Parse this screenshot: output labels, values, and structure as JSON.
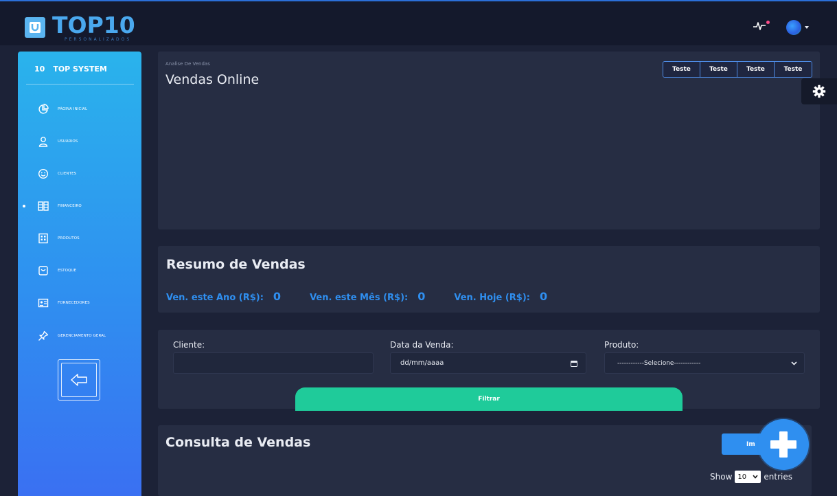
{
  "brand": {
    "logo_text": "TOP10",
    "logo_sub": "PERSONALIZADOS",
    "sidebar_num": "10",
    "sidebar_name": "TOP SYSTEM"
  },
  "header": {
    "icons": [
      "pulse-icon",
      "avatar",
      "chevron-down-icon"
    ]
  },
  "sidebar": {
    "items": [
      {
        "label": "PÁGINA INICIAL",
        "icon": "pie-chart-icon"
      },
      {
        "label": "USUÁRIOS",
        "icon": "user-icon"
      },
      {
        "label": "CLIENTES",
        "icon": "smile-icon"
      },
      {
        "label": "FINANCEIRO",
        "icon": "money-icon",
        "active": true
      },
      {
        "label": "PRODUTOS",
        "icon": "building-icon"
      },
      {
        "label": "ESTOQUE",
        "icon": "bag-icon"
      },
      {
        "label": "FORNECEDORES",
        "icon": "contact-card-icon"
      },
      {
        "label": "GERENCIAMENTO GERAL",
        "icon": "pin-icon"
      }
    ],
    "back_icon": "arrow-left-icon"
  },
  "vendas_online": {
    "breadcrumb": "Analise De Vendas",
    "title": "Vendas Online",
    "buttons": [
      "Teste",
      "Teste",
      "Teste",
      "Teste"
    ]
  },
  "resumo": {
    "title": "Resumo de Vendas",
    "stats": [
      {
        "label": "Ven. este Ano (R$):",
        "value": "0"
      },
      {
        "label": "Ven. este Mês (R$):",
        "value": "0"
      },
      {
        "label": "Ven. Hoje (R$):",
        "value": "0"
      }
    ]
  },
  "filter": {
    "cliente_label": "Cliente:",
    "cliente_value": "",
    "data_label": "Data da Venda:",
    "data_placeholder": "dd/mm/aaaa",
    "produto_label": "Produto:",
    "produto_selected": "------------Selecione------------",
    "filtrar_label": "Filtrar"
  },
  "consulta": {
    "title": "Consulta de Vendas",
    "button_label": "Im",
    "show_label": "Show",
    "entries_value": "10",
    "entries_label": "entries"
  },
  "colors": {
    "accent": "#2f8ff0",
    "success": "#1fcb9a",
    "background": "#1c2237",
    "card": "#262d43"
  }
}
